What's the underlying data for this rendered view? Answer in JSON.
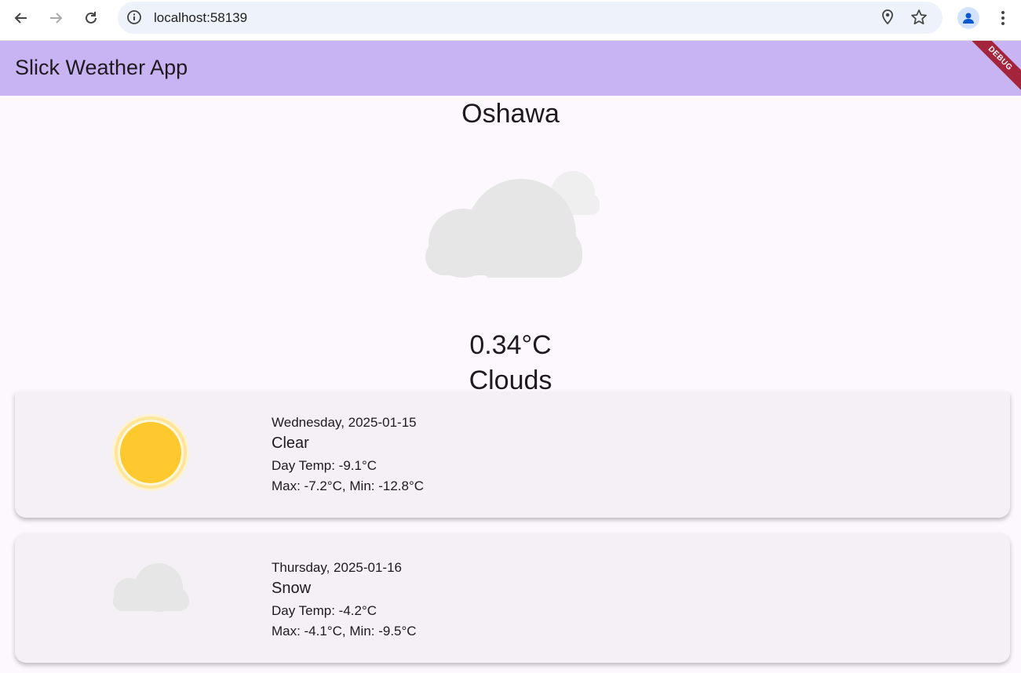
{
  "browser": {
    "url": "localhost:58139",
    "icons": [
      "back-icon",
      "forward-icon",
      "reload-icon",
      "site-info-icon",
      "location-icon",
      "bookmark-star-icon",
      "profile-icon",
      "more-menu-icon"
    ]
  },
  "appbar": {
    "title": "Slick Weather App",
    "debug_label": "DEBUG",
    "color": "#c9b4f3"
  },
  "current": {
    "city": "Oshawa",
    "temperature": "0.34°C",
    "condition": "Clouds",
    "icon": "clouds-icon"
  },
  "forecast": [
    {
      "date": "Wednesday, 2025-01-15",
      "description": "Clear",
      "day_temp": "Day Temp: -9.1°C",
      "min_max": "Max: -7.2°C, Min: -12.8°C",
      "icon": "sun-icon"
    },
    {
      "date": "Thursday, 2025-01-16",
      "description": "Snow",
      "day_temp": "Day Temp: -4.2°C",
      "min_max": "Max: -4.1°C, Min: -9.5°C",
      "icon": "cloud-icon"
    }
  ],
  "colors": {
    "background": "#fdf7fe",
    "card": "#f5eff6",
    "sun": "#fec92e",
    "cloud": "#e6e6e6",
    "debug_banner": "#a4243b"
  }
}
